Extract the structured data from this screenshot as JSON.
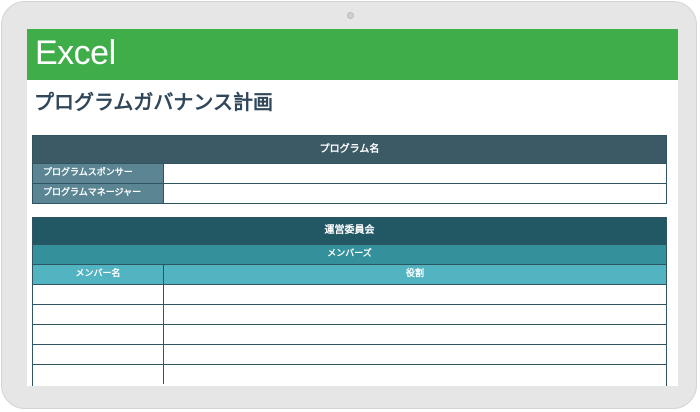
{
  "banner": {
    "title": "Excel"
  },
  "page": {
    "title": "プログラムガバナンス計画"
  },
  "program": {
    "header": "プログラム名",
    "rows": [
      {
        "label": "プログラムスポンサー",
        "value": ""
      },
      {
        "label": "プログラムマネージャー",
        "value": ""
      }
    ]
  },
  "committee": {
    "header": "運営委員会",
    "subheader": "メンバーズ",
    "columns": [
      "メンバー名",
      "役割"
    ],
    "rows": [
      {
        "name": "",
        "role": ""
      },
      {
        "name": "",
        "role": ""
      },
      {
        "name": "",
        "role": ""
      },
      {
        "name": "",
        "role": ""
      },
      {
        "name": "",
        "role": ""
      }
    ]
  },
  "colors": {
    "banner": "#3fae49",
    "title_text": "#30475a",
    "program_header": "#3b5a66",
    "program_label": "#5b8593",
    "committee_header": "#215864",
    "members_bar": "#34909b",
    "column_header": "#52b4c1"
  }
}
